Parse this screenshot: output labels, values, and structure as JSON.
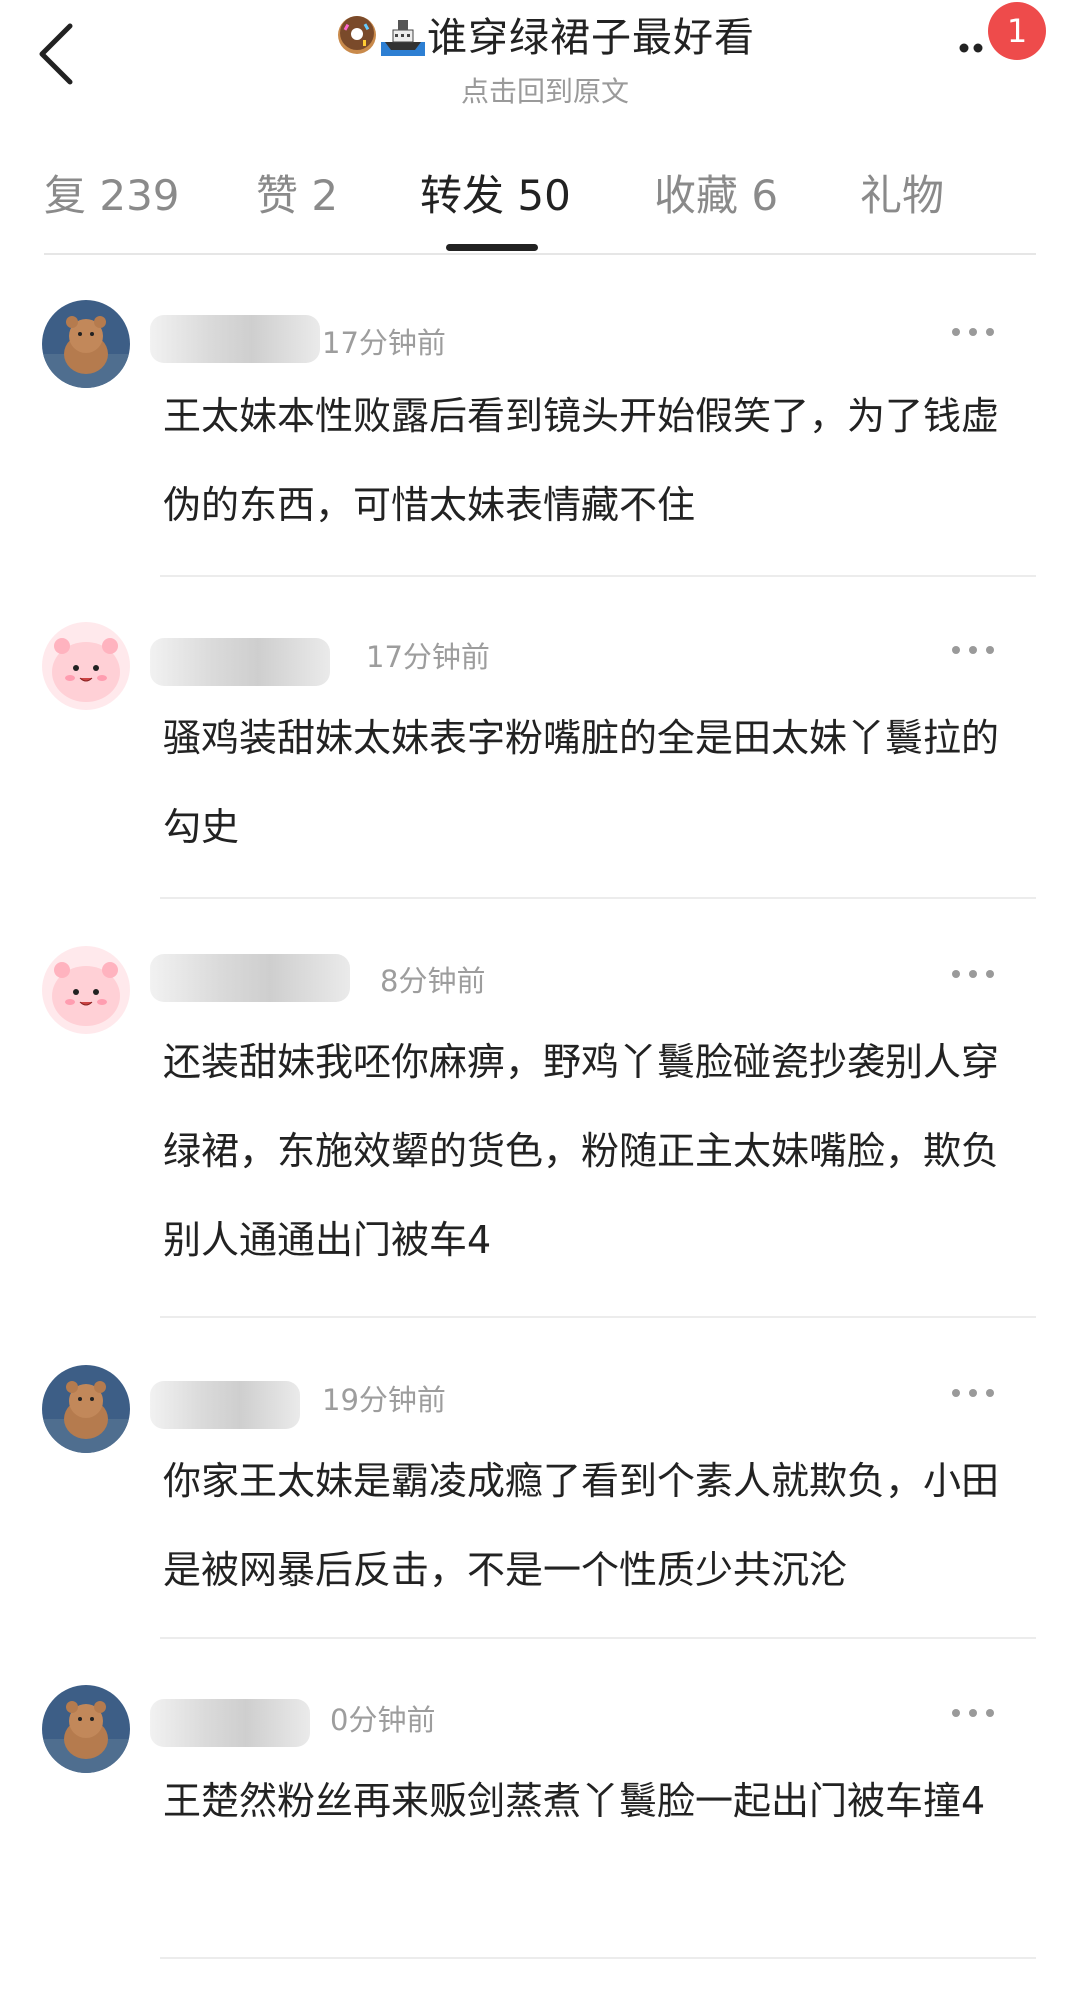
{
  "header": {
    "title": "谁穿绿裙子最好看",
    "subtitle": "点击回到原文",
    "notification_count": "1",
    "icons": [
      "back-arrow-icon",
      "donut-emoji-icon",
      "ship-emoji-icon",
      "more-icon"
    ]
  },
  "tabs": [
    {
      "label": "复 239",
      "active": false
    },
    {
      "label": "赞 2",
      "active": false
    },
    {
      "label": "转发 50",
      "active": true
    },
    {
      "label": "收藏 6",
      "active": false
    },
    {
      "label": "礼物",
      "active": false
    }
  ],
  "comments": [
    {
      "time": "17分钟前",
      "avatar": "bear-avatar",
      "text": "王太妹本性败露后看到镜头开始假笑了，为了钱虚伪的东西，可惜太妹表情藏不住"
    },
    {
      "time": "17分钟前",
      "avatar": "pink-cartoon-avatar",
      "text": "骚鸡装甜妹太妹表字粉嘴脏的全是田太妹丫鬟拉的勾史"
    },
    {
      "time": "8分钟前",
      "avatar": "pink-cartoon-avatar",
      "text": "还装甜妹我呸你麻痹，野鸡丫鬟脸碰瓷抄袭别人穿绿裙，东施效颦的货色，粉随正主太妹嘴脸，欺负别人通通出门被车4"
    },
    {
      "time": "19分钟前",
      "avatar": "bear-avatar",
      "text": "你家王太妹是霸凌成瘾了看到个素人就欺负，小田是被网暴后反击，不是一个性质少共沉沦"
    },
    {
      "time": "0分钟前",
      "avatar": "bear-avatar",
      "text": "王楚然粉丝再来贩剑蒸煮丫鬟脸一起出门被车撞4"
    }
  ],
  "colors": {
    "badge": "#ee4b4b",
    "secondary_text": "#9a9a9a",
    "active_tab": "#222222"
  }
}
